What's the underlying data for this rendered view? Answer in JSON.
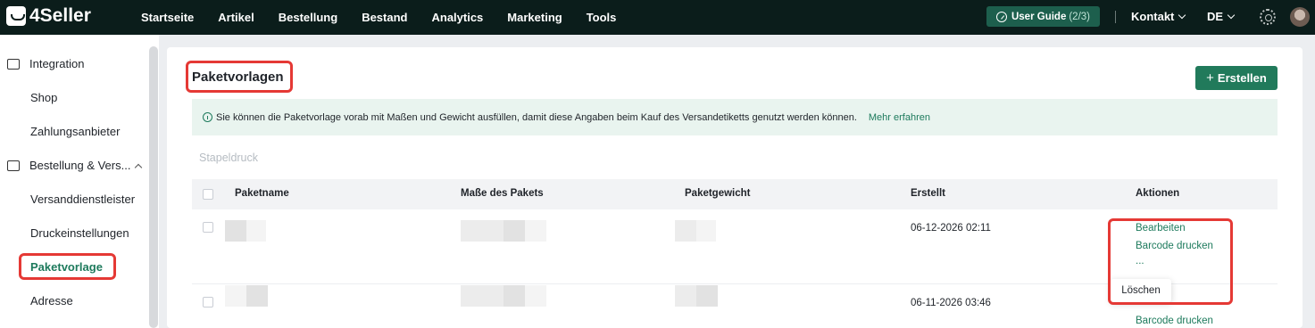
{
  "brand": {
    "name": "4Seller"
  },
  "nav": {
    "items": [
      "Startseite",
      "Artikel",
      "Bestellung",
      "Bestand",
      "Analytics",
      "Marketing",
      "Tools"
    ],
    "guide_label": "User Guide",
    "guide_count": "(2/3)",
    "contact": "Kontakt",
    "language": "DE"
  },
  "sidebar": {
    "integration": "Integration",
    "shop": "Shop",
    "payment": "Zahlungsanbieter",
    "orders_group": "Bestellung & Vers...",
    "carriers": "Versanddienstleister",
    "print_settings": "Druckeinstellungen",
    "package_template": "Paketvorlage",
    "address": "Adresse"
  },
  "page": {
    "title": "Paketvorlagen",
    "create_label": "Erstellen",
    "info_text": "Sie können die Paketvorlage vorab mit Maßen und Gewicht ausfüllen, damit diese Angaben beim Kauf des Versandetiketts genutzt werden können.",
    "info_link": "Mehr erfahren",
    "batch_print": "Stapeldruck"
  },
  "table": {
    "columns": [
      "Paketname",
      "Maße des Pakets",
      "Paketgewicht",
      "Erstellt",
      "Aktionen"
    ],
    "rows": [
      {
        "created": "06-12-2026 02:11",
        "actions": [
          "Bearbeiten",
          "Barcode drucken",
          "..."
        ]
      },
      {
        "created": "06-11-2026 03:46",
        "actions": [
          "Barcode drucken"
        ]
      }
    ],
    "popup_delete": "Löschen"
  },
  "colors": {
    "accent": "#217a5b",
    "topbar": "#0b1d1b",
    "highlight": "#e53935"
  }
}
